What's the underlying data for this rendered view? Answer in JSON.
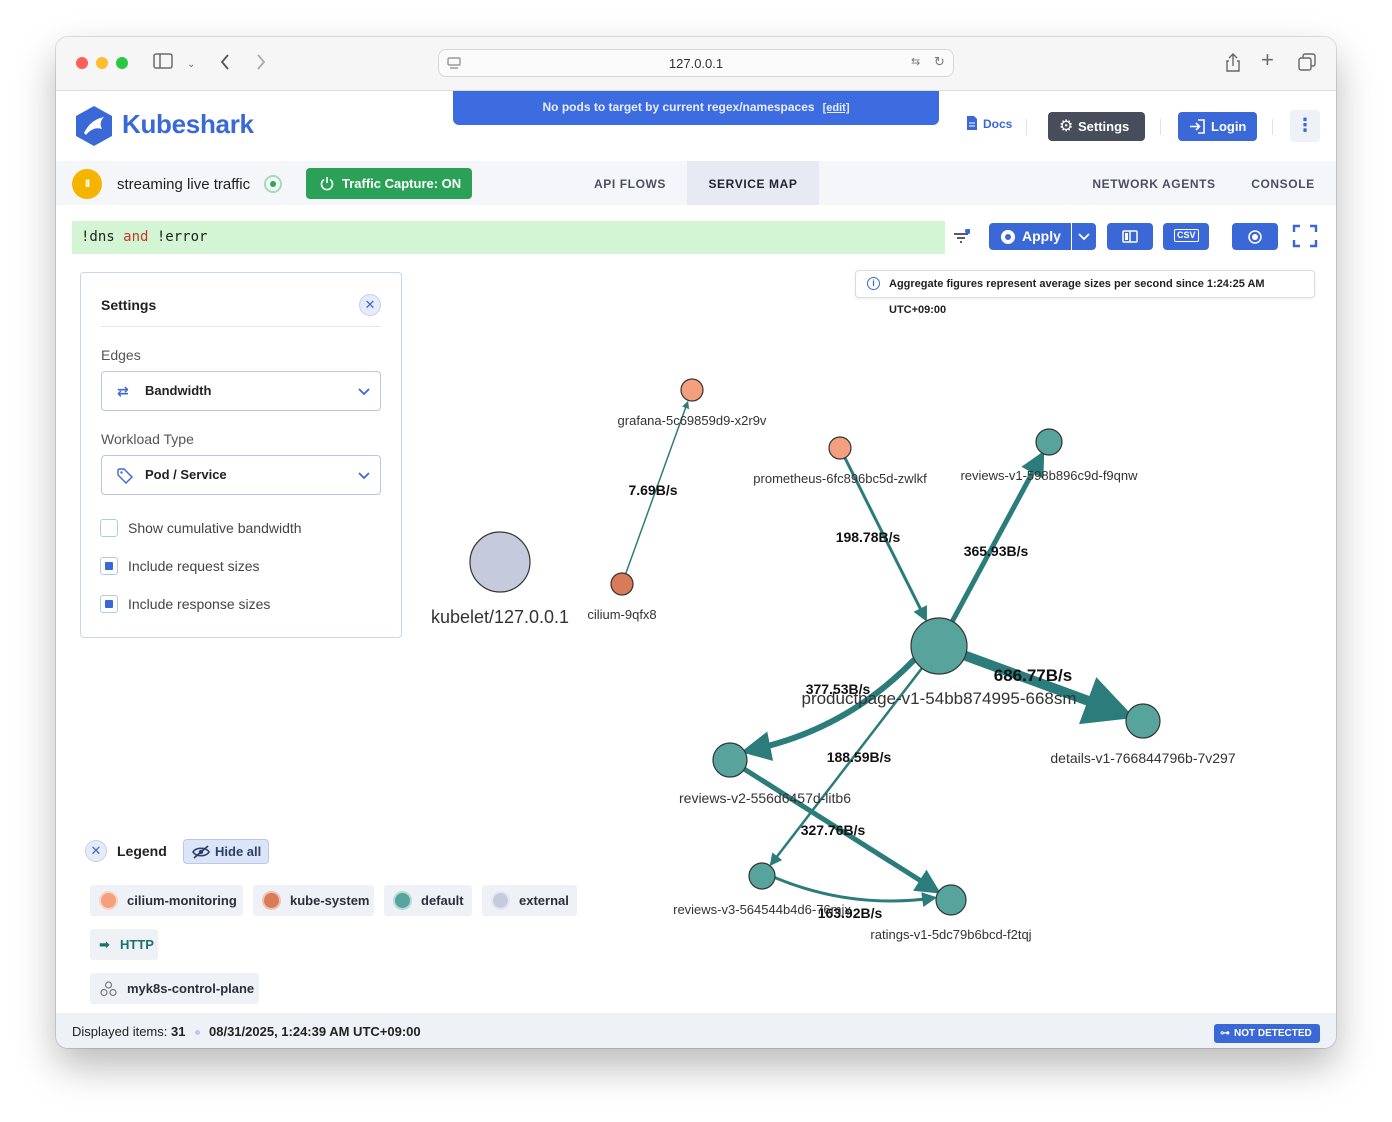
{
  "browser": {
    "url": "127.0.0.1"
  },
  "app": {
    "name": "Kubeshark",
    "banner_text": "No pods to target by current regex/namespaces",
    "banner_edit": "[edit]",
    "docs_label": "Docs",
    "settings_label": "Settings",
    "login_label": "Login"
  },
  "tabbar": {
    "pause_label": "II",
    "streaming_label": "streaming live traffic",
    "capture_label": "Traffic Capture: ON",
    "tabs": [
      {
        "label": "API FLOWS",
        "active": false
      },
      {
        "label": "SERVICE MAP",
        "active": true
      },
      {
        "label": "NETWORK AGENTS",
        "active": false
      },
      {
        "label": "CONSOLE",
        "active": false
      }
    ]
  },
  "filter": {
    "part1": "!dns ",
    "keyword": "and",
    "part2": " !error",
    "apply_label": "Apply",
    "csv_label": "CSV"
  },
  "settings_panel": {
    "title": "Settings",
    "edges_label": "Edges",
    "edges_value": "Bandwidth",
    "workload_label": "Workload Type",
    "workload_value": "Pod / Service",
    "checkboxes": [
      {
        "label": "Show cumulative bandwidth",
        "checked": false
      },
      {
        "label": "Include request sizes",
        "checked": true
      },
      {
        "label": "Include response sizes",
        "checked": true
      }
    ]
  },
  "info_text": "Aggregate figures represent average sizes per second since 1:24:25 AM UTC+09:00",
  "service_map": {
    "nodes": [
      {
        "id": "grafana",
        "label": "grafana-5c69859d9-x2r9v",
        "namespace": "cilium-monitoring"
      },
      {
        "id": "prometheus",
        "label": "prometheus-6fc896bc5d-zwlkf",
        "namespace": "cilium-monitoring"
      },
      {
        "id": "cilium",
        "label": "cilium-9qfx8",
        "namespace": "kube-system"
      },
      {
        "id": "kubelet",
        "label": "kubelet/127.0.0.1",
        "namespace": "external"
      },
      {
        "id": "reviews-v1",
        "label": "reviews-v1-598b896c9d-f9qnw",
        "namespace": "default"
      },
      {
        "id": "productpage",
        "label": "productpage-v1-54bb874995-668sm",
        "namespace": "default"
      },
      {
        "id": "details",
        "label": "details-v1-766844796b-7v297",
        "namespace": "default"
      },
      {
        "id": "reviews-v2",
        "label": "reviews-v2-556d6457d-litb6",
        "namespace": "default"
      },
      {
        "id": "reviews-v3",
        "label": "reviews-v3-564544b4d6-76mjx",
        "namespace": "default"
      },
      {
        "id": "ratings",
        "label": "ratings-v1-5dc79b6bcd-f2tqj",
        "namespace": "default"
      }
    ],
    "edges": [
      {
        "from": "cilium",
        "to": "grafana",
        "label": "7.69B/s"
      },
      {
        "from": "prometheus",
        "to": "productpage",
        "label": "198.78B/s"
      },
      {
        "from": "productpage",
        "to": "reviews-v1",
        "label": "365.93B/s"
      },
      {
        "from": "productpage",
        "to": "details",
        "label": "686.77B/s"
      },
      {
        "from": "productpage",
        "to": "reviews-v2",
        "label": "377.53B/s"
      },
      {
        "from": "productpage",
        "to": "reviews-v3",
        "label": "188.59B/s"
      },
      {
        "from": "reviews-v2",
        "to": "ratings",
        "label": "327.76B/s"
      },
      {
        "from": "reviews-v3",
        "to": "ratings",
        "label": "163.92B/s"
      }
    ]
  },
  "legend": {
    "title": "Legend",
    "hide_all_label": "Hide all",
    "namespaces": [
      {
        "label": "cilium-monitoring",
        "color": "#f4a07e"
      },
      {
        "label": "kube-system",
        "color": "#d97b59"
      },
      {
        "label": "default",
        "color": "#56a49c"
      },
      {
        "label": "external",
        "color": "#c5cbdd"
      }
    ],
    "protocol_label": "HTTP",
    "cluster_label": "myk8s-control-plane"
  },
  "status": {
    "displayed_label": "Displayed items:",
    "displayed_count": "31",
    "timestamp": "08/31/2025, 1:24:39 AM UTC+09:00",
    "detection_label": "NOT DETECTED"
  }
}
